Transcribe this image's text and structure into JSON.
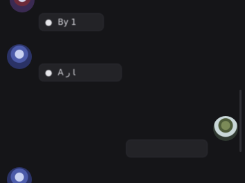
{
  "messages": [
    {
      "meta": {
        "name": "",
        "badge": ""
      },
      "bubble": {
        "lead": "●",
        "text": "By 1"
      }
    },
    {
      "meta": {
        "name": "",
        "badge": ""
      },
      "bubble": {
        "lead": "●",
        "text": "A ﺎ ﺭ"
      }
    },
    {
      "meta": {
        "name": "",
        "badge": ""
      },
      "bubble": {
        "text": ""
      }
    },
    {
      "meta": {
        "name": "",
        "badge": ""
      }
    }
  ],
  "system": {
    "text": "",
    "badge": ""
  }
}
